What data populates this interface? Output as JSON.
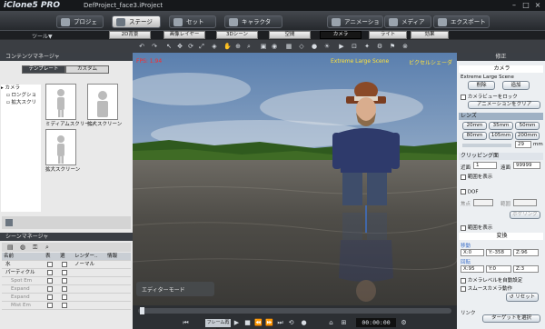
{
  "app": {
    "logo": "iClone5 PRO",
    "project_title": "DefProject_face3.iProject"
  },
  "main_tabs": [
    {
      "label": "プロジェクト"
    },
    {
      "label": "ステージ"
    },
    {
      "label": "セット"
    },
    {
      "label": "キャラクタ"
    },
    {
      "label": "アニメーション"
    },
    {
      "label": "メディア"
    },
    {
      "label": "エクスポート"
    }
  ],
  "sub_tabs": {
    "tools_label": "ツール▼",
    "items": [
      "2D背景",
      "画像レイヤー",
      "3Dシーン",
      "空間",
      "カメラ",
      "ライト",
      "効果"
    ],
    "selected": "カメラ"
  },
  "content_manager": {
    "title": "コンテンツマネージャ",
    "tabs": [
      "テンプレート",
      "カスタム"
    ],
    "tree": [
      "カメラ",
      "ロングショ",
      "拡大スクリ"
    ],
    "thumbs": [
      {
        "label": "ミディアムスクリーン"
      },
      {
        "label": "拡大スクリーン"
      },
      {
        "label": "拡大スクリーン"
      }
    ]
  },
  "scene_manager": {
    "title": "シーンマネージャ",
    "columns": [
      "名前",
      "表",
      "選",
      "レンダー..",
      "情報"
    ],
    "rows": [
      {
        "name": "水",
        "render": "ノーマル"
      },
      {
        "name": "パーティクル",
        "render": ""
      },
      {
        "name": "Spot Em",
        "render": ""
      },
      {
        "name": "Expand",
        "render": ""
      },
      {
        "name": "Expand",
        "render": ""
      },
      {
        "name": "Mist Em",
        "render": ""
      }
    ]
  },
  "viewport": {
    "fps": "FPS: 1.94",
    "view_name": "Extreme Large Scene",
    "view_mode": "ビクセルシェーダ",
    "editor_mode": "エディターモード"
  },
  "right_panel": {
    "title": "修正",
    "camera_header": "カメラ",
    "camera_name": "Extreme Large Scene",
    "delete_label": "削除",
    "add_label": "追加",
    "lock_label": "カメラビューをロック",
    "anim_clear_label": "アニメーションをクリア",
    "lens_header": "レンズ",
    "lens_buttons": [
      "20mm",
      "35mm",
      "50mm",
      "80mm",
      "105mm",
      "200mm"
    ],
    "lens_value": "29",
    "lens_unit": "mm",
    "clip_header": "クリッピング面",
    "clip_near_label": "近面",
    "clip_near": "1",
    "clip_far_label": "遠面",
    "clip_far": "99999",
    "show_range_label": "範囲を表示",
    "dof_label": "DOF",
    "focus_label": "焦点",
    "range_label": "範囲",
    "blur_label": "ボケリング",
    "show_range2_label": "範囲を表示",
    "transform_header": "変換",
    "move_label": "移動",
    "move_x": "X:0",
    "move_y": "Y:-358",
    "move_z": "Z:96",
    "rotate_label": "回転",
    "rot_x": "X:95",
    "rot_y": "Y:0",
    "rot_z": "Z:3",
    "level_label": "カメラレベルを自動設定",
    "smooth_label": "スムースカメラ動作",
    "reset_label": "リセット",
    "link_label": "リンク",
    "target_label": "ターゲットを選択"
  },
  "timeline": {
    "frame_mode": "フレーム再生",
    "time": "00:00:00"
  },
  "colors": {
    "accent": "#3d70c9",
    "fps": "#ff2a2a",
    "view_label": "#ffe23a"
  }
}
